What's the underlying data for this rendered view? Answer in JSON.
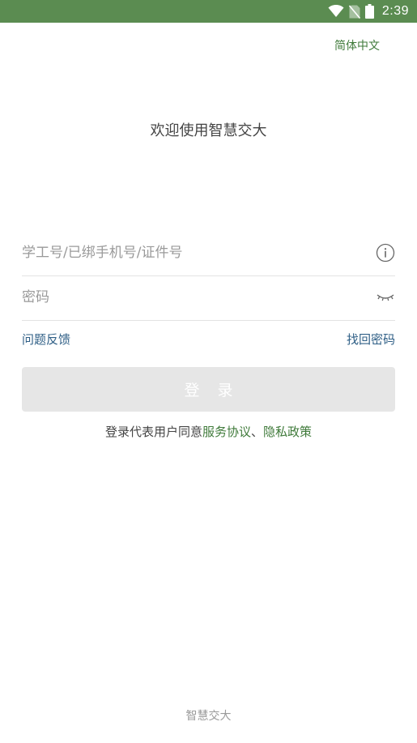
{
  "status_bar": {
    "time": "2:39",
    "background_color": "#5b8c51",
    "icons": [
      "wifi-icon",
      "no-sim-icon",
      "battery-icon"
    ]
  },
  "header": {
    "language_label": "简体中文"
  },
  "main": {
    "welcome_text": "欢迎使用智慧交大",
    "account_placeholder": "学工号/已绑手机号/证件号",
    "password_placeholder": "密码",
    "account_value": "",
    "password_value": "",
    "feedback_link": "问题反馈",
    "forgot_password_link": "找回密码",
    "login_label": "登 录",
    "agreement_prefix": "登录代表用户同意",
    "service_agreement_link": "服务协议",
    "separator": "、",
    "privacy_policy_link": "隐私政策"
  },
  "footer": {
    "app_name": "智慧交大"
  },
  "colors": {
    "accent_green": "#3f7a3a",
    "link_blue": "#2f5f86",
    "button_disabled": "#e6e6e6"
  }
}
